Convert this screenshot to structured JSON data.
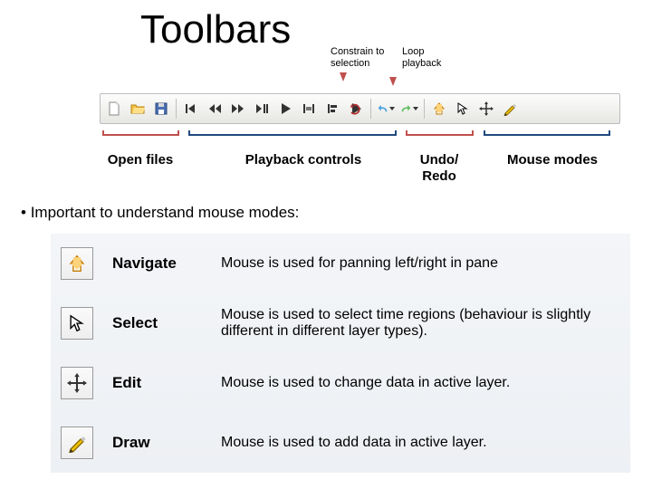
{
  "title": "Toolbars",
  "callouts": {
    "constrain": "Constrain to selection",
    "loop": "Loop playback"
  },
  "toolbar": {
    "groups": [
      {
        "id": "open-files",
        "buttons": [
          "new-file-icon",
          "open-file-icon",
          "save-icon"
        ]
      },
      {
        "id": "playback",
        "buttons": [
          "rewind-start-icon",
          "rewind-icon",
          "fast-forward-icon",
          "play-pause-icon",
          "play-icon",
          "constrain-selection-icon",
          "align-icon",
          "loop-playback-icon"
        ]
      },
      {
        "id": "undo-redo",
        "buttons": [
          "undo-icon",
          "redo-icon"
        ]
      },
      {
        "id": "mouse-modes",
        "buttons": [
          "navigate-mode-icon",
          "select-mode-icon",
          "edit-mode-icon",
          "draw-mode-icon"
        ]
      }
    ]
  },
  "group_labels": {
    "open_files": "Open files",
    "playback": "Playback controls",
    "undo": "Undo/ Redo",
    "mouse": "Mouse modes"
  },
  "bullet": "Important to understand mouse modes:",
  "modes": [
    {
      "icon": "navigate-mode-icon",
      "name": "Navigate",
      "desc": "Mouse is used for panning left/right in pane"
    },
    {
      "icon": "select-mode-icon",
      "name": "Select",
      "desc": "Mouse is used to select time regions (behaviour is slightly different in different layer types)."
    },
    {
      "icon": "edit-mode-icon",
      "name": "Edit",
      "desc": "Mouse is used to change data in active layer."
    },
    {
      "icon": "draw-mode-icon",
      "name": "Draw",
      "desc": "Mouse is used to add data in active layer."
    }
  ],
  "colors": {
    "accent_red": "#c0504d",
    "accent_blue": "#1f497d"
  }
}
